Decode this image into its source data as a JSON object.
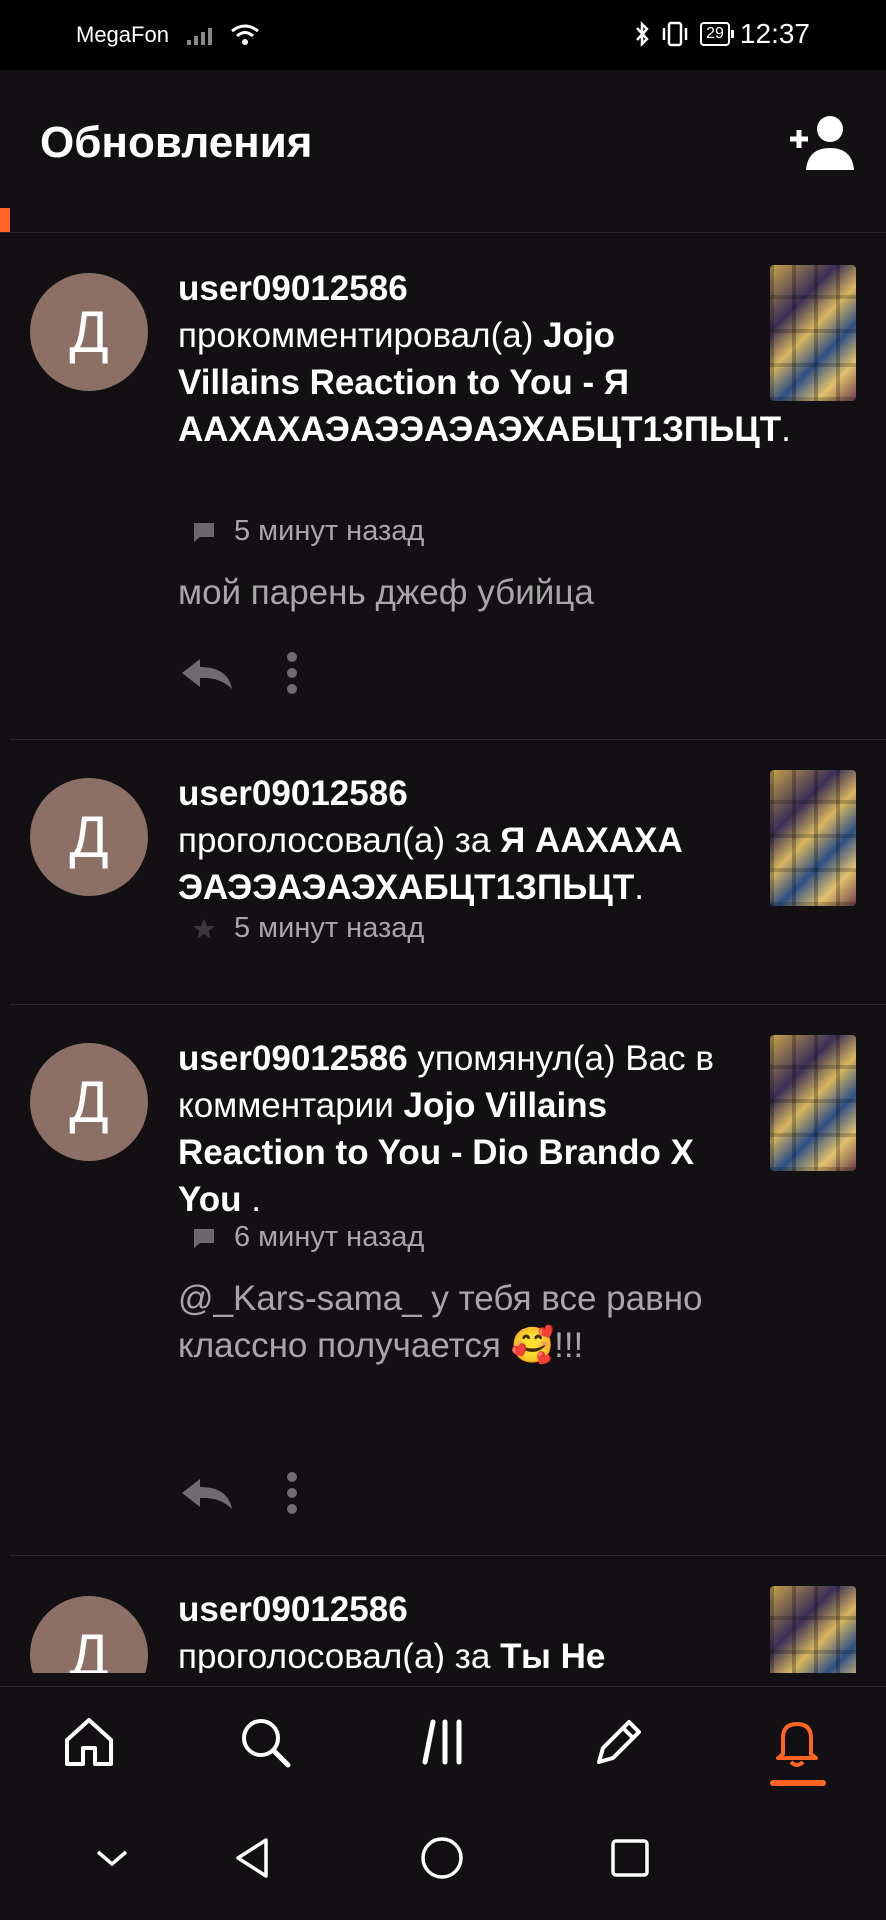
{
  "status_bar": {
    "carrier": "MegaFon",
    "battery": "29",
    "time": "12:37"
  },
  "header": {
    "title": "Обновления",
    "add_user_icon": "add-user-icon"
  },
  "accent_color": "#ff6422",
  "feed": [
    {
      "avatar_letter": "Д",
      "user": "user09012586",
      "action": "прокомментировал(а)",
      "story": "Jojo Villains Reaction to You - Я ААХАХАЭАЭЭАЭАЭХАБЦТ1ЗПЬЦТ",
      "after": ".",
      "meta_icon": "comment-icon",
      "time": "5 минут назад",
      "comment": "мой парень джеф убийца"
    },
    {
      "avatar_letter": "Д",
      "user": "user09012586",
      "action": "проголосовал(а) за",
      "story": "Я ААХАХА ЭАЭЭАЭАЭХАБЦТ1ЗПЬЦТ",
      "after": ".",
      "meta_icon": "star-icon",
      "time": "5 минут назад"
    },
    {
      "avatar_letter": "Д",
      "user": "user09012586",
      "action": "упомянул(а) Вас в комментарии",
      "story": "Jojo Villains Reaction to You - Dio Brando X You",
      "after": " .",
      "meta_icon": "comment-icon",
      "time": "6 минут назад",
      "comment": "@_Kars-sama_ у тебя все равно классно получается",
      "comment_emoji": "🥰",
      "comment_end": "!!!"
    },
    {
      "avatar_letter": "Д",
      "user": "user09012586",
      "action": "проголосовал(а) за",
      "story": "Ты Не"
    }
  ],
  "bottom_nav": [
    "home-icon",
    "search-icon",
    "library-icon",
    "write-icon",
    "notifications-icon"
  ],
  "system_nav": [
    "collapse-icon",
    "back-icon",
    "home-circle-icon",
    "recents-icon"
  ]
}
